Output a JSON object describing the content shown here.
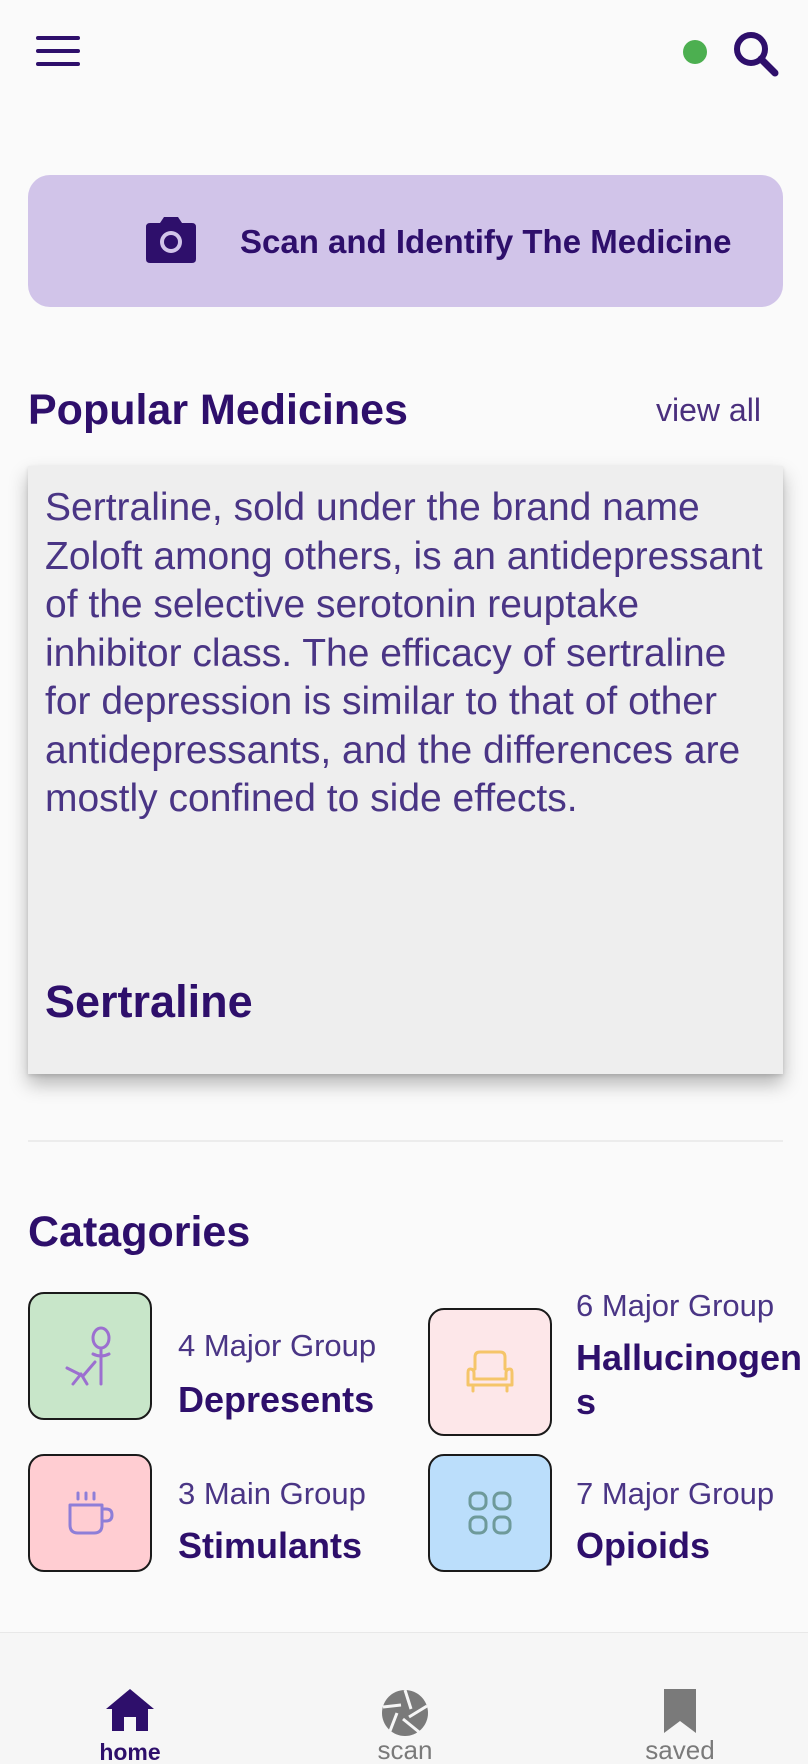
{
  "header": {
    "menu_icon": "hamburger-menu-icon",
    "status_color": "#4caf50",
    "search_icon": "search-icon"
  },
  "scan_banner": {
    "icon": "camera-icon",
    "label": "Scan and Identify The Medicine"
  },
  "popular": {
    "title": "Popular Medicines",
    "view_all": "view all",
    "card": {
      "description": "Sertraline, sold under the brand name Zoloft among others, is an antidepressant of the selective serotonin reuptake inhibitor class. The efficacy of sertraline for depression is similar to that of other antidepressants, and the differences are mostly confined to side effects.",
      "name": "Sertraline"
    }
  },
  "categories": {
    "title": "Catagories",
    "items": [
      {
        "group": "4 Major Group",
        "name": "Depresents",
        "icon": "relaxing-chair-icon",
        "tile_color": "#c8e6c9",
        "icon_color": "#9c6fd0"
      },
      {
        "group": "6 Major Group",
        "name": "Hallucinogens",
        "icon": "armchair-icon",
        "tile_color": "#fde7e9",
        "icon_color": "#f5c569"
      },
      {
        "group": "3 Main Group",
        "name": "Stimulants",
        "icon": "coffee-cup-icon",
        "tile_color": "#ffcdd2",
        "icon_color": "#8e7ed8"
      },
      {
        "group": "7 Major Group",
        "name": "Opioids",
        "icon": "pills-grid-icon",
        "tile_color": "#bbdefb",
        "icon_color": "#6e9a9a"
      }
    ]
  },
  "bottom_nav": {
    "items": [
      {
        "label": "home",
        "icon": "home-icon",
        "active": true
      },
      {
        "label": "scan",
        "icon": "aperture-icon",
        "active": false
      },
      {
        "label": "saved",
        "icon": "bookmark-icon",
        "active": false
      }
    ]
  },
  "colors": {
    "primary": "#2e0f6b",
    "banner": "#d1c4e9",
    "card": "#eeeeee",
    "background": "#fafafa"
  }
}
